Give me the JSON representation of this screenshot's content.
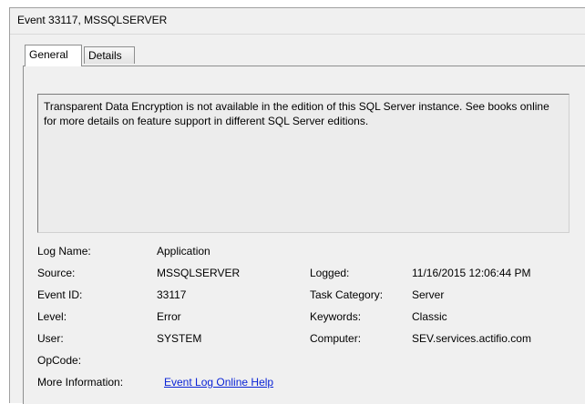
{
  "window": {
    "title": "Event 33117, MSSQLSERVER"
  },
  "tabs": [
    {
      "label": "General",
      "active": true
    },
    {
      "label": "Details",
      "active": false
    }
  ],
  "message": "Transparent Data Encryption is not available in the edition of this SQL Server instance. See books online for more details on feature support in different SQL Server editions.",
  "properties": {
    "log_name": {
      "label": "Log Name:",
      "value": "Application"
    },
    "source": {
      "label": "Source:",
      "value": "MSSQLSERVER"
    },
    "logged": {
      "label": "Logged:",
      "value": "11/16/2015 12:06:44 PM"
    },
    "event_id": {
      "label": "Event ID:",
      "value": "33117"
    },
    "task_category": {
      "label": "Task Category:",
      "value": "Server"
    },
    "level": {
      "label": "Level:",
      "value": "Error"
    },
    "keywords": {
      "label": "Keywords:",
      "value": "Classic"
    },
    "user": {
      "label": "User:",
      "value": "SYSTEM"
    },
    "computer": {
      "label": "Computer:",
      "value": "SEV.services.actifio.com"
    },
    "opcode": {
      "label": "OpCode:",
      "value": ""
    },
    "more_info": {
      "label": "More Information:",
      "link_text": "Event Log Online Help"
    }
  }
}
